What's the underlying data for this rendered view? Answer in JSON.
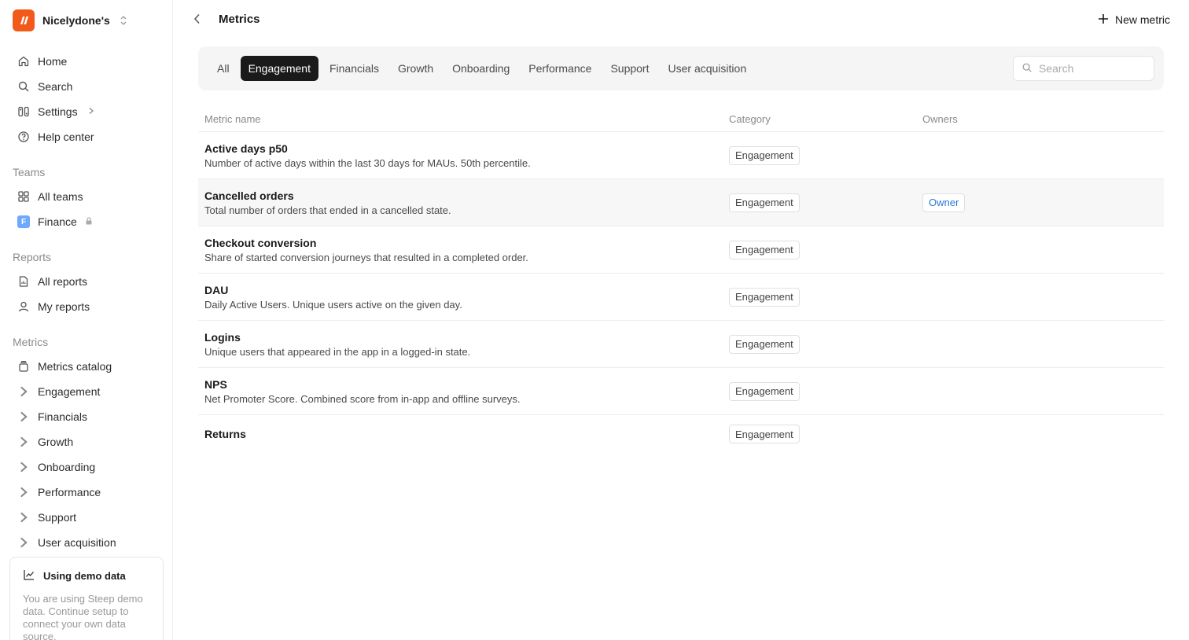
{
  "sidebar": {
    "workspace_name": "Nicelydone's",
    "nav": [
      {
        "label": "Home",
        "icon": "home-icon"
      },
      {
        "label": "Search",
        "icon": "search-icon"
      },
      {
        "label": "Settings",
        "icon": "settings-icon"
      },
      {
        "label": "Help center",
        "icon": "help-icon"
      }
    ],
    "teams_label": "Teams",
    "teams": [
      {
        "label": "All teams",
        "icon": "grid-icon"
      },
      {
        "label": "Finance",
        "badge": "F"
      }
    ],
    "reports_label": "Reports",
    "reports": [
      {
        "label": "All reports",
        "icon": "report-icon"
      },
      {
        "label": "My reports",
        "icon": "user-icon"
      }
    ],
    "metrics_label": "Metrics",
    "metrics_catalog": "Metrics catalog",
    "metric_categories": [
      "Engagement",
      "Financials",
      "Growth",
      "Onboarding",
      "Performance",
      "Support",
      "User acquisition"
    ],
    "demo": {
      "title": "Using demo data",
      "text": "You are using Steep demo data. Continue setup to connect your own data source."
    }
  },
  "header": {
    "title": "Metrics",
    "new_metric_label": "New metric"
  },
  "tabs": [
    "All",
    "Engagement",
    "Financials",
    "Growth",
    "Onboarding",
    "Performance",
    "Support",
    "User acquisition"
  ],
  "active_tab": "Engagement",
  "search": {
    "placeholder": "Search",
    "value": ""
  },
  "table": {
    "headers": {
      "name": "Metric name",
      "category": "Category",
      "owners": "Owners"
    },
    "rows": [
      {
        "name": "Active days p50",
        "description": "Number of active days within the last 30 days for MAUs. 50th percentile.",
        "category": "Engagement",
        "owner": ""
      },
      {
        "name": "Cancelled orders",
        "description": "Total number of orders that ended in a cancelled state.",
        "category": "Engagement",
        "owner": "Owner"
      },
      {
        "name": "Checkout conversion",
        "description": "Share of started conversion journeys that resulted in a completed order.",
        "category": "Engagement",
        "owner": ""
      },
      {
        "name": "DAU",
        "description": "Daily Active Users. Unique users active on the given day.",
        "category": "Engagement",
        "owner": ""
      },
      {
        "name": "Logins",
        "description": "Unique users that appeared in the app in a logged-in state.",
        "category": "Engagement",
        "owner": ""
      },
      {
        "name": "NPS",
        "description": "Net Promoter Score. Combined score from in-app and offline surveys.",
        "category": "Engagement",
        "owner": ""
      },
      {
        "name": "Returns",
        "description": "",
        "category": "Engagement",
        "owner": ""
      }
    ]
  },
  "colors": {
    "brand": "#f25a1c",
    "active_tab": "#1a1a1a",
    "owner_link": "#2a78d6"
  }
}
